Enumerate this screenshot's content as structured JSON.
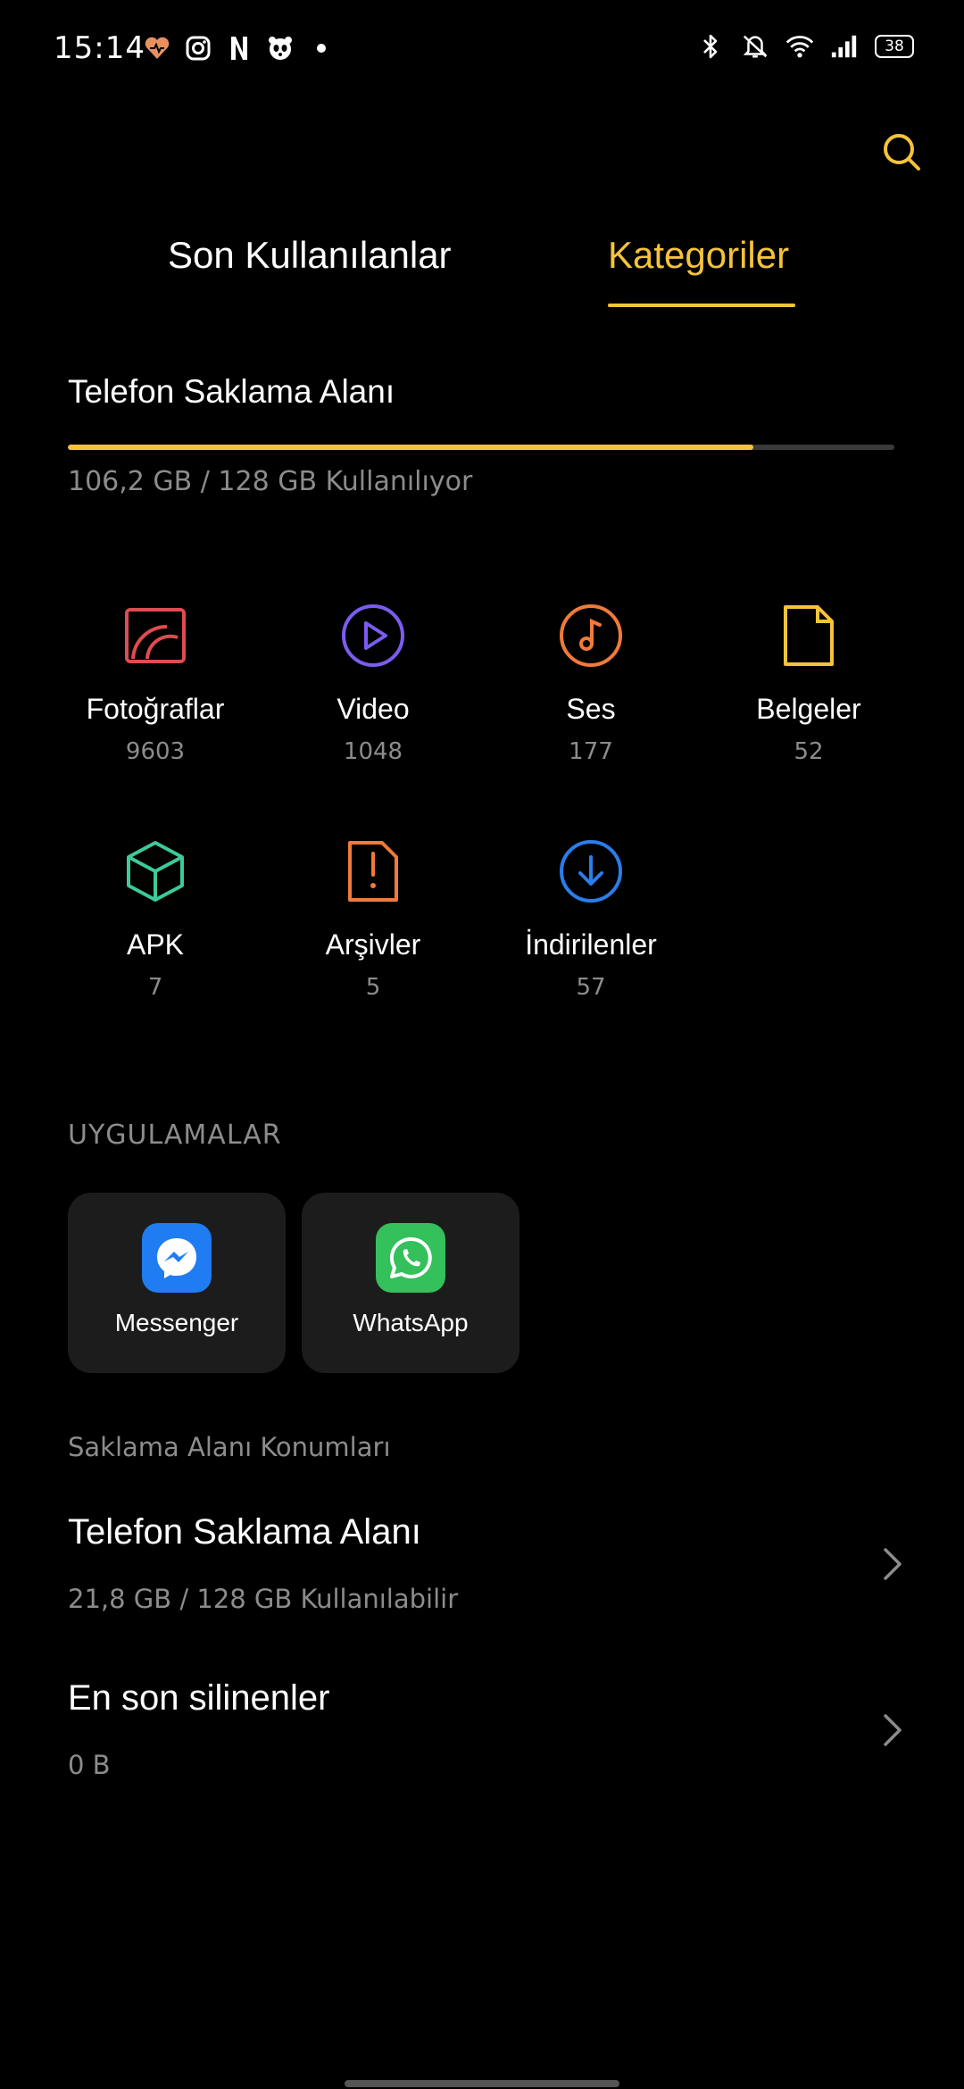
{
  "status_bar": {
    "time": "15:14",
    "battery": "38",
    "left_icons": [
      "health-icon",
      "instagram-icon",
      "netflix-icon",
      "panda-icon",
      "dot-icon"
    ],
    "right_icons": [
      "bluetooth-icon",
      "mute-icon",
      "wifi-icon",
      "signal-icon",
      "battery-icon"
    ]
  },
  "tabs": [
    {
      "label": "Son Kullanılanlar",
      "active": false
    },
    {
      "label": "Kategoriler",
      "active": true
    }
  ],
  "storage": {
    "title": "Telefon Saklama Alanı",
    "usage": "106,2 GB / 128 GB Kullanılıyor",
    "used_fraction": 0.8297
  },
  "categories": [
    {
      "label": "Fotoğraflar",
      "count": "9603",
      "icon": "photo-icon",
      "color": "#e04b4f"
    },
    {
      "label": "Video",
      "count": "1048",
      "icon": "play-icon",
      "color": "#7b5cf0"
    },
    {
      "label": "Ses",
      "count": "177",
      "icon": "music-note-icon",
      "color": "#f07a3a"
    },
    {
      "label": "Belgeler",
      "count": "52",
      "icon": "document-icon",
      "color": "#f5c33b"
    },
    {
      "label": "APK",
      "count": "7",
      "icon": "package-icon",
      "color": "#3ec99a"
    },
    {
      "label": "Arşivler",
      "count": "5",
      "icon": "archive-icon",
      "color": "#f07a3a"
    },
    {
      "label": "İndirilenler",
      "count": "57",
      "icon": "download-icon",
      "color": "#2b7de9"
    }
  ],
  "apps": {
    "title": "UYGULAMALAR",
    "items": [
      {
        "label": "Messenger",
        "icon": "messenger-icon",
        "color": "#1f7cf2"
      },
      {
        "label": "WhatsApp",
        "icon": "whatsapp-icon",
        "color": "#34c05a"
      }
    ]
  },
  "locations": {
    "title": "Saklama Alanı Konumları",
    "items": [
      {
        "name": "Telefon Saklama Alanı",
        "sub": "21,8 GB / 128 GB Kullanılabilir"
      },
      {
        "name": "En son silinenler",
        "sub": "0 B"
      }
    ]
  },
  "colors": {
    "accent": "#f5c33b",
    "background": "#000000",
    "card": "#1c1c1c",
    "muted_text": "#8c8c8c"
  }
}
